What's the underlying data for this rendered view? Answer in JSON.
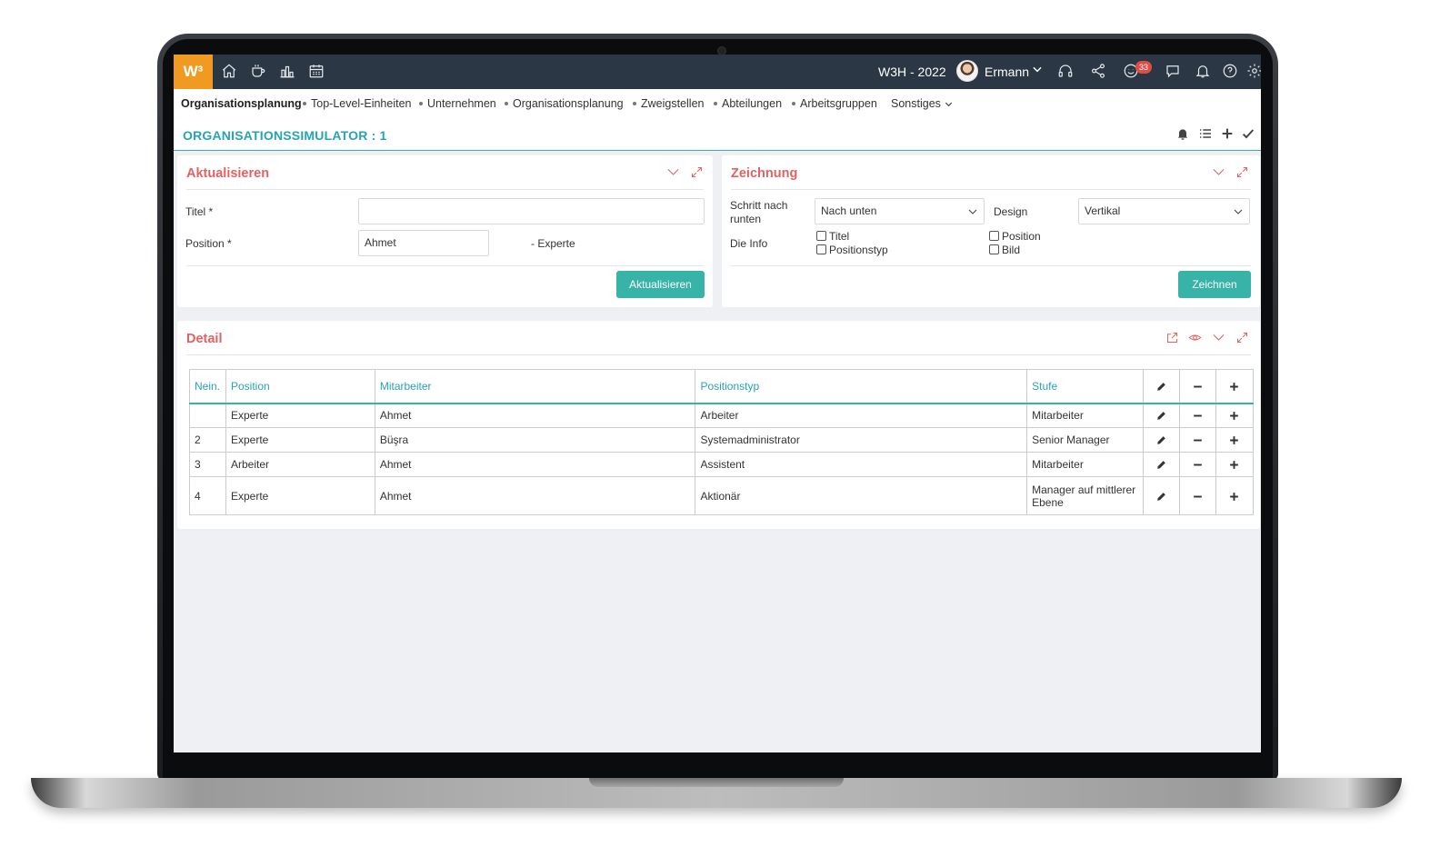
{
  "topbar": {
    "logo": "W³",
    "nav_icons": [
      "home-icon",
      "coffee-icon",
      "bar-chart-icon",
      "calendar-icon"
    ],
    "year_label": "W3H - 2022",
    "user_name": "Ermann",
    "right_icons": [
      "headset-icon",
      "share-icon",
      "smiley-icon",
      "chat-icon",
      "bell-icon",
      "help-icon",
      "gear-icon"
    ],
    "badge_count": "33"
  },
  "nav": {
    "items": [
      "Organisationsplanung",
      "Top-Level-Einheiten",
      "Unternehmen",
      "Organisationsplanung",
      "Zweigstellen",
      "Abteilungen",
      "Arbeitsgruppen",
      "Sonstiges"
    ]
  },
  "page": {
    "title": "ORGANISATIONSSIMULATOR : 1",
    "actions": [
      "bell-icon",
      "list-icon",
      "plus-icon",
      "check-icon"
    ]
  },
  "update_card": {
    "title": "Aktualisieren",
    "title_label": "Titel *",
    "title_value": "",
    "position_label": "Position *",
    "position_value": "Ahmet",
    "position_suffix": "- Experte",
    "button": "Aktualisieren"
  },
  "draw_card": {
    "title": "Zeichnung",
    "step_label": "Schritt nach runten",
    "step_value": "Nach unten",
    "design_label": "Design",
    "design_value": "Vertikal",
    "info_label": "Die Info",
    "checkboxes": [
      "Titel",
      "Positionstyp",
      "Position",
      "Bild"
    ],
    "button": "Zeichnen"
  },
  "detail_card": {
    "title": "Detail",
    "columns": [
      "Nein.",
      "Position",
      "Mitarbeiter",
      "Positionstyp",
      "Stufe"
    ],
    "rows": [
      [
        "",
        "Experte",
        "Ahmet",
        "Arbeiter",
        "Mitarbeiter"
      ],
      [
        "2",
        "Experte",
        "Büşra",
        "Systemadministrator",
        "Senior Manager"
      ],
      [
        "3",
        "Arbeiter",
        "Ahmet",
        "Assistent",
        "Mitarbeiter"
      ],
      [
        "4",
        "Experte",
        "Ahmet",
        "Aktionär",
        "Manager auf mittlerer Ebene"
      ]
    ]
  },
  "colors": {
    "topbar": "#2b3745",
    "logo": "#f09a21",
    "accent": "#37b3a7",
    "title_blue": "#27a3b7",
    "card_title": "#e26262",
    "badge": "#e14d45"
  }
}
